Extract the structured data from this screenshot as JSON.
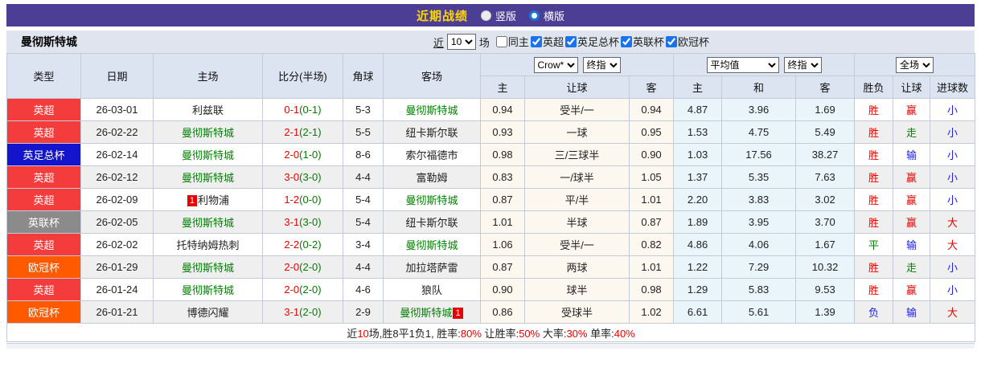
{
  "titlebar": {
    "title": "近期战绩",
    "view_options": [
      {
        "label": "竖版",
        "selected": false
      },
      {
        "label": "横版",
        "selected": true
      }
    ]
  },
  "toolbar": {
    "team_name": "曼彻斯特城",
    "recent_label": "近",
    "recent_count": "10",
    "unit_label": "场",
    "same_home": {
      "label": "同主",
      "checked": false
    },
    "league_filters": [
      {
        "label": "英超",
        "checked": true
      },
      {
        "label": "英足总杯",
        "checked": true
      },
      {
        "label": "英联杯",
        "checked": true
      },
      {
        "label": "欧冠杯",
        "checked": true
      }
    ]
  },
  "table": {
    "left_headers": [
      "类型",
      "日期",
      "主场",
      "比分(半场)",
      "角球",
      "客场"
    ],
    "groups": [
      {
        "selects": [
          "Crow*",
          "终指"
        ],
        "columns": [
          "主",
          "让球",
          "客"
        ]
      },
      {
        "selects": [
          "平均值",
          "终指"
        ],
        "columns": [
          "主",
          "和",
          "客"
        ]
      },
      {
        "selects": [
          "全场"
        ],
        "columns": [
          "胜负",
          "让球",
          "进球数"
        ]
      }
    ],
    "colors": {
      "league": {
        "英超": "#f43c3c",
        "英足总杯": "#1414cc",
        "英联杯": "#8b8b8b",
        "欧冠杯": "#ff5a00"
      },
      "win": "#e60000",
      "draw": "#008000",
      "lose": "#1e1ee0",
      "team_highlight": "#008000"
    },
    "rows": [
      {
        "type": "英超",
        "date": "26-03-01",
        "home": "利兹联",
        "home_green": false,
        "home_rank": "",
        "home_rank_pos": "",
        "score_ft": "0-1",
        "score_ht": "(0-1)",
        "corners": "5-3",
        "away": "曼彻斯特城",
        "away_green": true,
        "away_rank": "",
        "away_rank_pos": "",
        "odds1": [
          "0.94",
          "受半/一",
          "0.94"
        ],
        "odds2": [
          "4.87",
          "3.96",
          "1.69"
        ],
        "results": [
          [
            "胜",
            "win"
          ],
          [
            "赢",
            "win"
          ],
          [
            "小",
            "lose"
          ]
        ]
      },
      {
        "type": "英超",
        "date": "26-02-22",
        "home": "曼彻斯特城",
        "home_green": true,
        "home_rank": "",
        "home_rank_pos": "",
        "score_ft": "2-1",
        "score_ht": "(2-1)",
        "corners": "5-5",
        "away": "纽卡斯尔联",
        "away_green": false,
        "away_rank": "",
        "away_rank_pos": "",
        "odds1": [
          "0.93",
          "一球",
          "0.95"
        ],
        "odds2": [
          "1.53",
          "4.75",
          "5.49"
        ],
        "results": [
          [
            "胜",
            "win"
          ],
          [
            "走",
            "draw"
          ],
          [
            "小",
            "lose"
          ]
        ]
      },
      {
        "type": "英足总杯",
        "date": "26-02-14",
        "home": "曼彻斯特城",
        "home_green": true,
        "home_rank": "",
        "home_rank_pos": "",
        "score_ft": "2-0",
        "score_ht": "(1-0)",
        "corners": "8-6",
        "away": "索尔福德市",
        "away_green": false,
        "away_rank": "",
        "away_rank_pos": "",
        "odds1": [
          "0.98",
          "三/三球半",
          "0.90"
        ],
        "odds2": [
          "1.03",
          "17.56",
          "38.27"
        ],
        "results": [
          [
            "胜",
            "win"
          ],
          [
            "输",
            "lose"
          ],
          [
            "小",
            "lose"
          ]
        ]
      },
      {
        "type": "英超",
        "date": "26-02-12",
        "home": "曼彻斯特城",
        "home_green": true,
        "home_rank": "",
        "home_rank_pos": "",
        "score_ft": "3-0",
        "score_ht": "(3-0)",
        "corners": "4-4",
        "away": "富勒姆",
        "away_green": false,
        "away_rank": "",
        "away_rank_pos": "",
        "odds1": [
          "0.83",
          "一/球半",
          "1.05"
        ],
        "odds2": [
          "1.37",
          "5.35",
          "7.63"
        ],
        "results": [
          [
            "胜",
            "win"
          ],
          [
            "赢",
            "win"
          ],
          [
            "小",
            "lose"
          ]
        ]
      },
      {
        "type": "英超",
        "date": "26-02-09",
        "home": "利物浦",
        "home_green": false,
        "home_rank": "1",
        "home_rank_pos": "left",
        "score_ft": "1-2",
        "score_ht": "(0-0)",
        "corners": "5-4",
        "away": "曼彻斯特城",
        "away_green": true,
        "away_rank": "",
        "away_rank_pos": "",
        "odds1": [
          "0.87",
          "平/半",
          "1.01"
        ],
        "odds2": [
          "2.20",
          "3.83",
          "3.02"
        ],
        "results": [
          [
            "胜",
            "win"
          ],
          [
            "赢",
            "win"
          ],
          [
            "小",
            "lose"
          ]
        ]
      },
      {
        "type": "英联杯",
        "date": "26-02-05",
        "home": "曼彻斯特城",
        "home_green": true,
        "home_rank": "",
        "home_rank_pos": "",
        "score_ft": "3-1",
        "score_ht": "(3-0)",
        "corners": "5-4",
        "away": "纽卡斯尔联",
        "away_green": false,
        "away_rank": "",
        "away_rank_pos": "",
        "odds1": [
          "1.01",
          "半球",
          "0.87"
        ],
        "odds2": [
          "1.89",
          "3.95",
          "3.70"
        ],
        "results": [
          [
            "胜",
            "win"
          ],
          [
            "赢",
            "win"
          ],
          [
            "大",
            "win"
          ]
        ]
      },
      {
        "type": "英超",
        "date": "26-02-02",
        "home": "托特纳姆热刺",
        "home_green": false,
        "home_rank": "",
        "home_rank_pos": "",
        "score_ft": "2-2",
        "score_ht": "(0-2)",
        "corners": "3-4",
        "away": "曼彻斯特城",
        "away_green": true,
        "away_rank": "",
        "away_rank_pos": "",
        "odds1": [
          "1.06",
          "受半/一",
          "0.82"
        ],
        "odds2": [
          "4.86",
          "4.06",
          "1.67"
        ],
        "results": [
          [
            "平",
            "draw"
          ],
          [
            "输",
            "lose"
          ],
          [
            "大",
            "win"
          ]
        ]
      },
      {
        "type": "欧冠杯",
        "date": "26-01-29",
        "home": "曼彻斯特城",
        "home_green": true,
        "home_rank": "",
        "home_rank_pos": "",
        "score_ft": "2-0",
        "score_ht": "(2-0)",
        "corners": "4-4",
        "away": "加拉塔萨雷",
        "away_green": false,
        "away_rank": "",
        "away_rank_pos": "",
        "odds1": [
          "0.87",
          "两球",
          "1.01"
        ],
        "odds2": [
          "1.22",
          "7.29",
          "10.32"
        ],
        "results": [
          [
            "胜",
            "win"
          ],
          [
            "走",
            "draw"
          ],
          [
            "小",
            "lose"
          ]
        ]
      },
      {
        "type": "英超",
        "date": "26-01-24",
        "home": "曼彻斯特城",
        "home_green": true,
        "home_rank": "",
        "home_rank_pos": "",
        "score_ft": "2-0",
        "score_ht": "(2-0)",
        "corners": "4-6",
        "away": "狼队",
        "away_green": false,
        "away_rank": "",
        "away_rank_pos": "",
        "odds1": [
          "0.90",
          "球半",
          "0.98"
        ],
        "odds2": [
          "1.29",
          "5.83",
          "9.53"
        ],
        "results": [
          [
            "胜",
            "win"
          ],
          [
            "赢",
            "win"
          ],
          [
            "小",
            "lose"
          ]
        ]
      },
      {
        "type": "欧冠杯",
        "date": "26-01-21",
        "home": "博德闪耀",
        "home_green": false,
        "home_rank": "",
        "home_rank_pos": "",
        "score_ft": "3-1",
        "score_ht": "(2-0)",
        "corners": "2-9",
        "away": "曼彻斯特城",
        "away_green": true,
        "away_rank": "1",
        "away_rank_pos": "right",
        "odds1": [
          "0.86",
          "受球半",
          "1.02"
        ],
        "odds2": [
          "6.61",
          "5.61",
          "1.39"
        ],
        "results": [
          [
            "负",
            "lose"
          ],
          [
            "输",
            "lose"
          ],
          [
            "大",
            "win"
          ]
        ]
      }
    ],
    "summary_parts": [
      [
        "近",
        "black"
      ],
      [
        "10",
        "red"
      ],
      [
        "场,胜8平1负1, 胜率:",
        "black"
      ],
      [
        "80%",
        "red"
      ],
      [
        " 让胜率:",
        "black"
      ],
      [
        "50%",
        "red"
      ],
      [
        " 大率:",
        "black"
      ],
      [
        "30%",
        "red"
      ],
      [
        " 单率:",
        "black"
      ],
      [
        "40%",
        "red"
      ]
    ]
  }
}
